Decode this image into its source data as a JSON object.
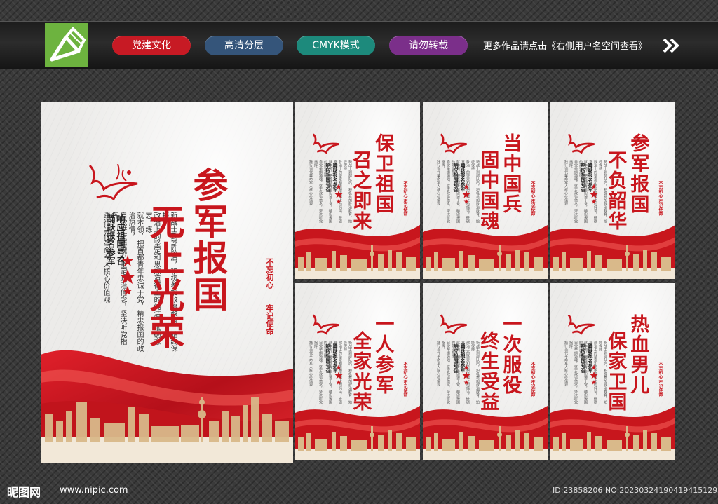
{
  "header": {
    "buttons": [
      {
        "label": "党建文化",
        "color": "#c71a24"
      },
      {
        "label": "高清分层",
        "color": "#35557a"
      },
      {
        "label": "CMYK模式",
        "color": "#1d8a7c"
      },
      {
        "label": "请勿转载",
        "color": "#7b2f8a"
      }
    ],
    "notice": "更多作品请点击《右侧用户名空间查看》"
  },
  "main_poster": {
    "title_col1": "参军报国",
    "title_col2": "无上光荣",
    "subtitle_col1": "响应祖国号召",
    "subtitle_col2": "踊跃报名参军",
    "body_cols": [
      "新战士到部队后，积极参加政治教育，始终保持",
      "政治上的坚定和思想道德上的纯洁，砥砺意志，练",
      "就本领，把首都青年忠诚于党，精忠报国的政治热情，",
      "自觉举旗铸魂，坚定政治信念，坚决听党指挥，",
      "践行当代革命军人核心价值观"
    ],
    "seal_1": "不忘初心",
    "seal_2": "牢记使命"
  },
  "small_posters": [
    {
      "col1": "保卫祖国",
      "col2": "召之即来"
    },
    {
      "col1": "当中国兵",
      "col2": "固中国魂"
    },
    {
      "col1": "参军报国",
      "col2": "不负韶华"
    },
    {
      "col1": "一人参军",
      "col2": "全家光荣"
    },
    {
      "col1": "一次服役",
      "col2": "终生受益"
    },
    {
      "col1": "热血男儿",
      "col2": "保家卫国"
    }
  ],
  "small_common": {
    "sub1": "响应祖国号召",
    "sub2": "踊跃报名参军",
    "seal": "不忘初心  牢记使命"
  },
  "footer": {
    "site_name": "昵图网",
    "site_url": "www.nipic.com",
    "id_text": "ID:23858206 NO:20230324190419415129"
  }
}
